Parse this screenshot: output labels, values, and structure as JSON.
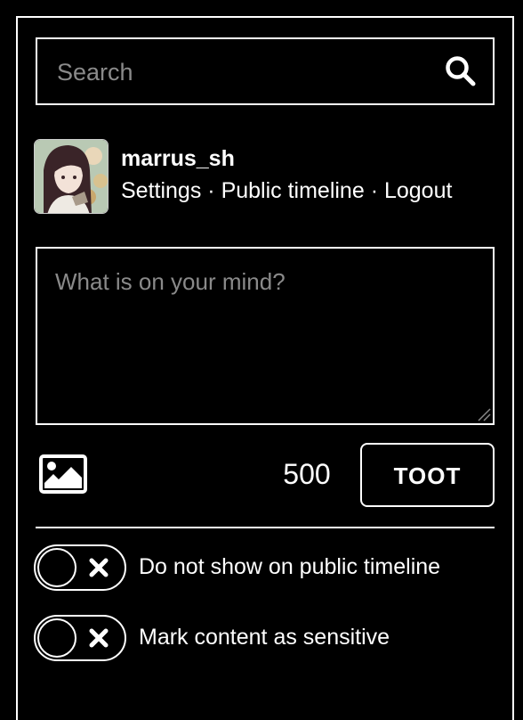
{
  "search": {
    "placeholder": "Search",
    "icon": "search-icon"
  },
  "profile": {
    "username": "marrus_sh",
    "links": [
      {
        "label": "Settings"
      },
      {
        "label": "Public timeline"
      },
      {
        "label": "Logout"
      }
    ],
    "separator": " · "
  },
  "compose": {
    "placeholder": "What is on your mind?",
    "char_counter": "500",
    "submit_label": "TOOT",
    "media_icon": "image-icon"
  },
  "options": [
    {
      "label": "Do not show on public timeline",
      "checked": false
    },
    {
      "label": "Mark content as sensitive",
      "checked": false
    }
  ],
  "colors": {
    "background": "#000000",
    "foreground": "#ffffff",
    "placeholder": "#8a8a8a"
  }
}
